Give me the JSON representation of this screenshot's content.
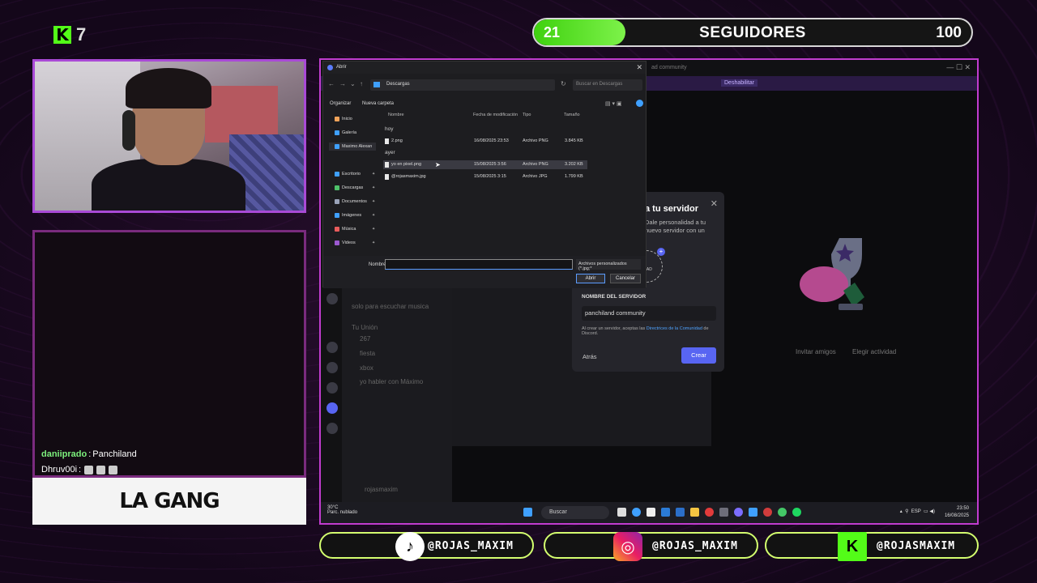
{
  "overlay": {
    "kick_count": "7",
    "followers": {
      "current": "21",
      "label": "SEGUIDORES",
      "goal": "100",
      "progress_fraction": 0.21
    },
    "chat": [
      {
        "user": "daniiprado",
        "sep": " : ",
        "message": "Panchiland",
        "emotes": 0
      },
      {
        "user": "Dhruv00i",
        "sep": " : ",
        "message": "",
        "emotes": 3
      }
    ],
    "banner": "LA GANG",
    "socials": [
      {
        "platform_icon": "tiktok-icon",
        "handle": "@ROJAS_MAXIM"
      },
      {
        "platform_icon": "instagram-icon",
        "handle": "@ROJAS_MAXIM"
      },
      {
        "platform_icon": "kick-icon",
        "handle": "@ROJASMAXIM"
      }
    ],
    "colors": {
      "kick_green": "#53fc18",
      "frame_purple": "#c13ccf",
      "accent_blurple": "#5865f2"
    }
  },
  "discord": {
    "title_fragment": "ad community",
    "banner_action": "Deshabilitar",
    "main_actions": [
      "Invitar amigos",
      "Elegir actividad"
    ],
    "channels": [
      "solo para escuchar musica",
      "Tu Unión",
      "267",
      "fiesta",
      "xbox",
      "yo habler con Máximo"
    ],
    "user_name": "rojasmaxim"
  },
  "server_modal": {
    "title": "a tu servidor",
    "description": "Dale personalidad a tu nuevo servidor con un nombre y un icono. Siempre puedes cambiarlo más tarde.",
    "upload_label": "LOAD",
    "field_label": "NOMBRE DEL SERVIDOR",
    "field_value": "panchiland community",
    "terms_prefix": "Al crear un servidor, aceptas las ",
    "terms_link": "Directrices de la Comunidad",
    "terms_suffix": " de Discord.",
    "back_label": "Atrás",
    "create_label": "Crear",
    "close_icon": "close-icon"
  },
  "file_dialog": {
    "title": "Abrir",
    "path": "Descargas",
    "search_placeholder": "Buscar en Descargas",
    "organize_label": "Organizar",
    "new_folder_label": "Nueva carpeta",
    "sidebar": [
      {
        "label": "Inicio",
        "icon": "home-icon",
        "color": "#f0a35a"
      },
      {
        "label": "Galería",
        "icon": "gallery-icon",
        "color": "#3fa0ff"
      },
      {
        "label": "Maximo Alexan",
        "icon": "cloud-icon",
        "color": "#3fa0ff"
      },
      {
        "label": "Escritorio",
        "icon": "desktop-icon",
        "color": "#3fa0ff"
      },
      {
        "label": "Descargas",
        "icon": "download-icon",
        "color": "#4fc16a"
      },
      {
        "label": "Documentos",
        "icon": "documents-icon",
        "color": "#9aa3b8"
      },
      {
        "label": "Imágenes",
        "icon": "images-icon",
        "color": "#3fa0ff"
      },
      {
        "label": "Música",
        "icon": "music-icon",
        "color": "#e85c5c"
      },
      {
        "label": "Videos",
        "icon": "videos-icon",
        "color": "#9b59d0"
      }
    ],
    "columns": [
      "Nombre",
      "Fecha de modificación",
      "Tipo",
      "Tamaño"
    ],
    "groups": [
      {
        "label": "hoy",
        "files": [
          {
            "name": "2.png",
            "date": "16/08/2025 23:53",
            "type": "Archivo PNG",
            "size": "3.845 KB"
          }
        ]
      },
      {
        "label": "ayer",
        "files": [
          {
            "name": "yo en pixel.png",
            "date": "15/08/2025 3:56",
            "type": "Archivo PNG",
            "size": "3.202 KB"
          },
          {
            "name": "@rojasmaxim.jpg",
            "date": "15/08/2025 3:15",
            "type": "Archivo JPG",
            "size": "1.799 KB"
          }
        ]
      }
    ],
    "name_label": "Nombre:",
    "name_value": "",
    "filter_value": "Archivos personalizados (*.jpg;*",
    "open_label": "Abrir",
    "cancel_label": "Cancelar"
  },
  "taskbar": {
    "weather_temp": "30°C",
    "weather_desc": "Parc. nublado",
    "search_label": "Buscar",
    "lang": "ESP",
    "time": "23:50",
    "date": "16/08/2025"
  }
}
